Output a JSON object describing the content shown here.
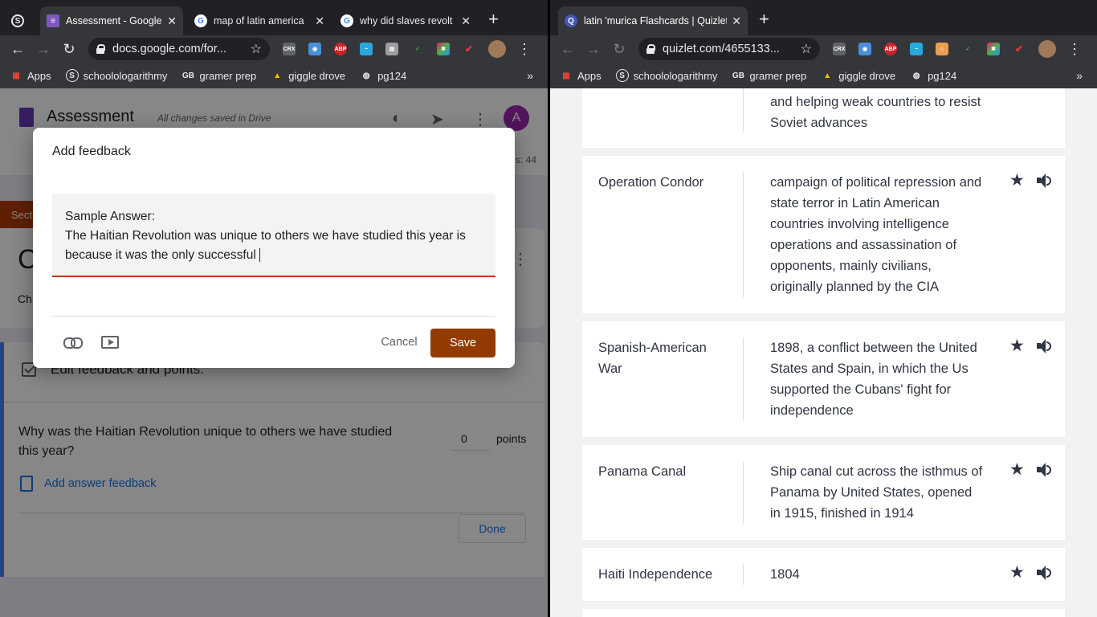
{
  "left_browser": {
    "tabs": [
      {
        "title": "Assessment - Google Forms",
        "active": true
      },
      {
        "title": "map of latin america",
        "active": false
      },
      {
        "title": "why did slaves revolt",
        "active": false
      }
    ],
    "url": "docs.google.com/for...",
    "bookmarks": [
      "Apps",
      "schoolologarithmy",
      "gramer prep",
      "giggle drove",
      "pg124"
    ],
    "overflow_chevron": "»"
  },
  "forms": {
    "title": "Assessment",
    "save_status": "All changes saved in Drive",
    "avatar_letter": "A",
    "responses_total": "s: 44",
    "section_tab": "Sect",
    "card_title_fragment": "C",
    "card_sub_fragment": "Ch",
    "edit_label": "Edit feedback and points:",
    "question": "Why was the Haitian Revolution unique to others we have studied this year?",
    "points_value": "0",
    "points_label": "points",
    "add_feedback": "Add answer feedback",
    "done_label": "Done"
  },
  "dialog": {
    "title": "Add feedback",
    "line1": "Sample Answer:",
    "line2": "The Haitian Revolution was unique to others we have studied this year is",
    "line3": "because it was the only successful",
    "cancel_label": "Cancel",
    "save_label": "Save"
  },
  "right_browser": {
    "tabs": [
      {
        "title": "latin 'murica Flashcards | Quizlet",
        "active": true
      }
    ],
    "url": "quizlet.com/4655133...",
    "bookmarks": [
      "Apps",
      "schoolologarithmy",
      "gramer prep",
      "giggle drove",
      "pg124"
    ],
    "overflow_chevron": "»"
  },
  "quizlet": {
    "partial_def": "and helping weak countries to resist Soviet advances",
    "cards": [
      {
        "term": "Operation Condor",
        "definition": "campaign of political repression and state terror in Latin American countries involving intelligence operations and assassination of opponents, mainly civilians, originally planned by the CIA"
      },
      {
        "term": "Spanish-American War",
        "definition": "1898, a conflict between the United States and Spain, in which the Us supported the Cubans' fight for independence"
      },
      {
        "term": "Panama Canal",
        "definition": "Ship canal cut across the isthmus of Panama by United States, opened in 1915, finished in 1914"
      },
      {
        "term": "Haiti Independence",
        "definition": "1804"
      }
    ]
  },
  "colors": {
    "forms_purple": "#673ab7",
    "theme_rust": "#933a00",
    "chrome_dark": "#35363a",
    "quizlet_text": "#303545"
  }
}
